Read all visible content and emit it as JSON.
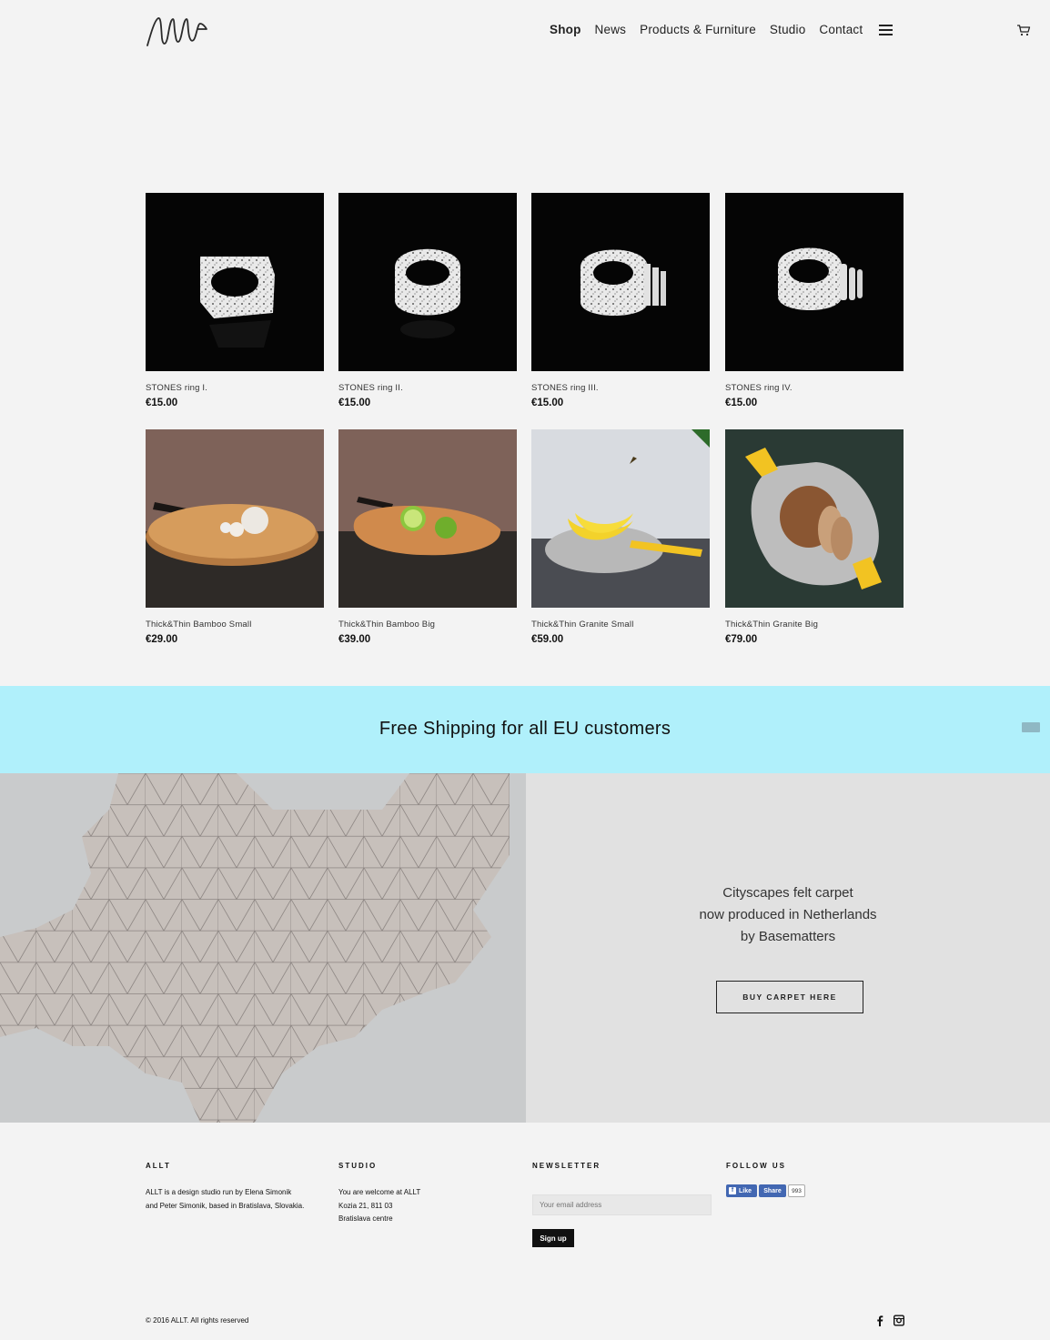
{
  "header": {
    "logo_text": "ALLT",
    "nav": [
      "Shop",
      "News",
      "Products & Furniture",
      "Studio",
      "Contact"
    ]
  },
  "products": [
    {
      "name": "STONES ring I.",
      "price": "€15.00",
      "image": "stones-ring-1"
    },
    {
      "name": "STONES ring II.",
      "price": "€15.00",
      "image": "stones-ring-2"
    },
    {
      "name": "STONES ring III.",
      "price": "€15.00",
      "image": "stones-ring-3"
    },
    {
      "name": "STONES ring IV.",
      "price": "€15.00",
      "image": "stones-ring-4"
    },
    {
      "name": "Thick&Thin Bamboo Small",
      "price": "€29.00",
      "image": "bamboo-board-garlic"
    },
    {
      "name": "Thick&Thin Bamboo Big",
      "price": "€39.00",
      "image": "bamboo-board-limes"
    },
    {
      "name": "Thick&Thin Granite Small",
      "price": "€59.00",
      "image": "granite-board-bananas"
    },
    {
      "name": "Thick&Thin Granite Big",
      "price": "€79.00",
      "image": "granite-board-bread"
    }
  ],
  "banner": {
    "text": "Free Shipping for all EU customers",
    "color": "#b0f0fb"
  },
  "promo": {
    "line1": "Cityscapes felt carpet",
    "line2": "now produced in Netherlands",
    "line3": "by Basematters",
    "button": "BUY CARPET HERE"
  },
  "footer": {
    "allt": {
      "title": "ALLT",
      "line1": "ALLT is a design studio run by Elena Simonik",
      "line2": "and Peter Simonik, based in Bratislava, Slovakia."
    },
    "studio": {
      "title": "STUDIO",
      "line1": "You are welcome at ALLT",
      "line2": "Kozia 21, 811 03",
      "line3": "Bratislava centre"
    },
    "newsletter": {
      "title": "NEWSLETTER",
      "placeholder": "Your email address",
      "button": "Sign up"
    },
    "follow": {
      "title": "FOLLOW US",
      "like": "Like",
      "share": "Share",
      "count": "993"
    },
    "copyright": "© 2016 ALLT. All rights reserved"
  }
}
